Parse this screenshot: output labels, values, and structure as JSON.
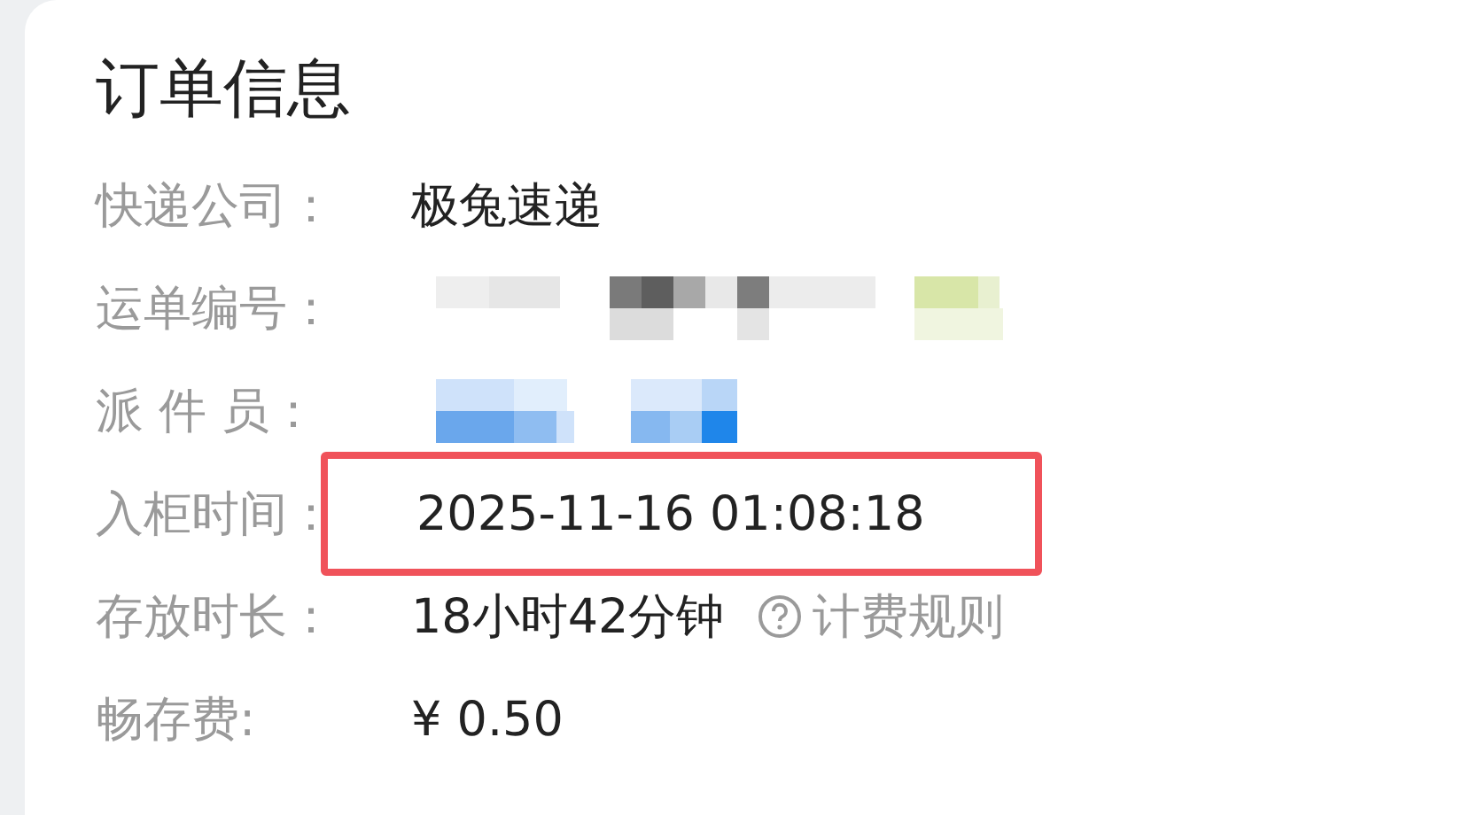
{
  "card": {
    "title": "订单信息",
    "rows": [
      {
        "kind": "text",
        "label": "快递公司：",
        "value": "极兔速递"
      },
      {
        "kind": "mosaic",
        "label": "运单编号："
      },
      {
        "kind": "mosaic",
        "label": "派 件 员："
      },
      {
        "kind": "text",
        "label": "入柜时间：",
        "value": "2025-11-16 01:08:18",
        "highlighted": true
      },
      {
        "kind": "text",
        "label": "存放时长：",
        "value": "18小时42分钟",
        "link": "计费规则"
      },
      {
        "kind": "text",
        "label": "畅存费:",
        "value": "¥ 0.50"
      }
    ]
  }
}
